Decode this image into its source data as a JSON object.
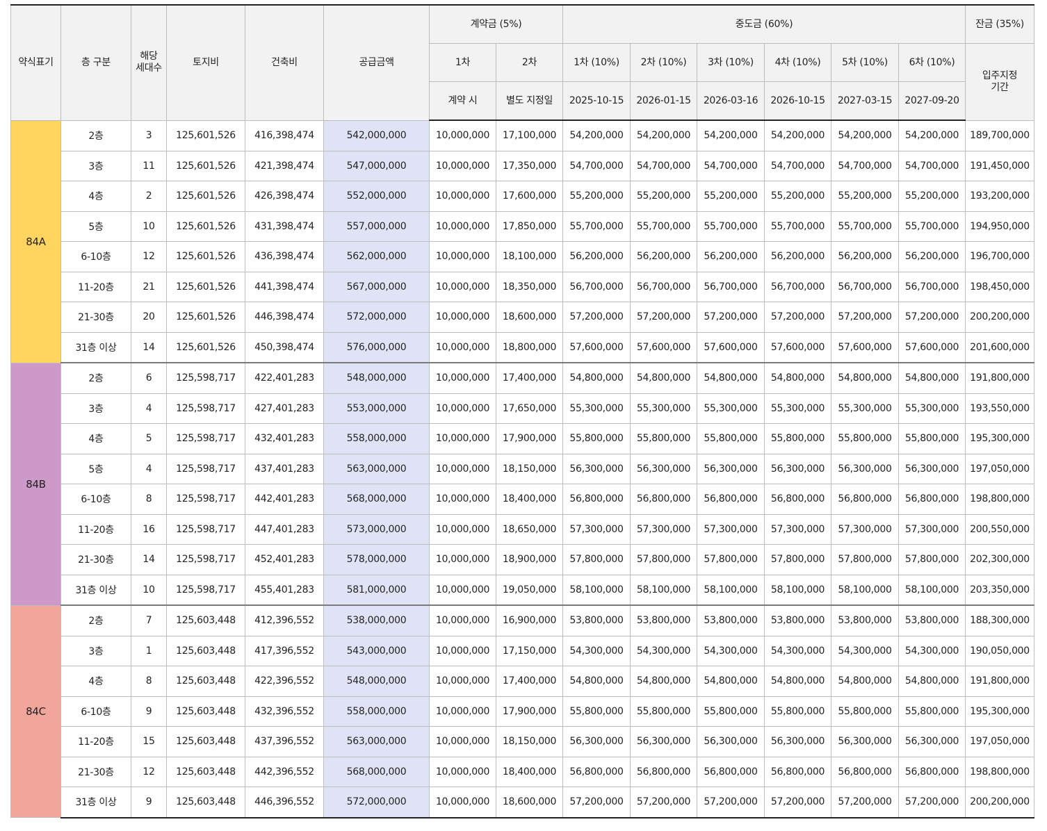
{
  "header": {
    "type": "약식표기",
    "floor": "층 구분",
    "units": "해당\n세대수",
    "land": "토지비",
    "building": "건축비",
    "supply": "공급금액",
    "deposit_group": "계약금 (5%)",
    "middle_group": "중도금 (60%)",
    "balance_group": "잔금 (35%)",
    "dep1": "1차",
    "dep2": "2차",
    "mid1": "1차 (10%)",
    "mid2": "2차 (10%)",
    "mid3": "3차 (10%)",
    "mid4": "4차 (10%)",
    "mid5": "5차 (10%)",
    "mid6": "6차 (10%)",
    "balance_sub": "입주지정\n기간",
    "dep1_date": "계약 시",
    "dep2_date": "별도 지정일",
    "mid1_date": "2025-10-15",
    "mid2_date": "2026-01-15",
    "mid3_date": "2026-03-16",
    "mid4_date": "2026-10-15",
    "mid5_date": "2027-03-15",
    "mid6_date": "2027-09-20"
  },
  "groups": [
    {
      "type": "84A",
      "color": "#ffd45f",
      "rows": [
        {
          "floor": "2층",
          "units": "3",
          "land": "125,601,526",
          "building": "416,398,474",
          "supply": "542,000,000",
          "dep1": "10,000,000",
          "dep2": "17,100,000",
          "mid": "54,200,000",
          "balance": "189,700,000"
        },
        {
          "floor": "3층",
          "units": "11",
          "land": "125,601,526",
          "building": "421,398,474",
          "supply": "547,000,000",
          "dep1": "10,000,000",
          "dep2": "17,350,000",
          "mid": "54,700,000",
          "balance": "191,450,000"
        },
        {
          "floor": "4층",
          "units": "2",
          "land": "125,601,526",
          "building": "426,398,474",
          "supply": "552,000,000",
          "dep1": "10,000,000",
          "dep2": "17,600,000",
          "mid": "55,200,000",
          "balance": "193,200,000"
        },
        {
          "floor": "5층",
          "units": "10",
          "land": "125,601,526",
          "building": "431,398,474",
          "supply": "557,000,000",
          "dep1": "10,000,000",
          "dep2": "17,850,000",
          "mid": "55,700,000",
          "balance": "194,950,000"
        },
        {
          "floor": "6-10층",
          "units": "12",
          "land": "125,601,526",
          "building": "436,398,474",
          "supply": "562,000,000",
          "dep1": "10,000,000",
          "dep2": "18,100,000",
          "mid": "56,200,000",
          "balance": "196,700,000"
        },
        {
          "floor": "11-20층",
          "units": "21",
          "land": "125,601,526",
          "building": "441,398,474",
          "supply": "567,000,000",
          "dep1": "10,000,000",
          "dep2": "18,350,000",
          "mid": "56,700,000",
          "balance": "198,450,000"
        },
        {
          "floor": "21-30층",
          "units": "20",
          "land": "125,601,526",
          "building": "446,398,474",
          "supply": "572,000,000",
          "dep1": "10,000,000",
          "dep2": "18,600,000",
          "mid": "57,200,000",
          "balance": "200,200,000"
        },
        {
          "floor": "31층 이상",
          "units": "14",
          "land": "125,601,526",
          "building": "450,398,474",
          "supply": "576,000,000",
          "dep1": "10,000,000",
          "dep2": "18,800,000",
          "mid": "57,600,000",
          "balance": "201,600,000"
        }
      ]
    },
    {
      "type": "84B",
      "color": "#cc99c8",
      "rows": [
        {
          "floor": "2층",
          "units": "6",
          "land": "125,598,717",
          "building": "422,401,283",
          "supply": "548,000,000",
          "dep1": "10,000,000",
          "dep2": "17,400,000",
          "mid": "54,800,000",
          "balance": "191,800,000"
        },
        {
          "floor": "3층",
          "units": "4",
          "land": "125,598,717",
          "building": "427,401,283",
          "supply": "553,000,000",
          "dep1": "10,000,000",
          "dep2": "17,650,000",
          "mid": "55,300,000",
          "balance": "193,550,000"
        },
        {
          "floor": "4층",
          "units": "5",
          "land": "125,598,717",
          "building": "432,401,283",
          "supply": "558,000,000",
          "dep1": "10,000,000",
          "dep2": "17,900,000",
          "mid": "55,800,000",
          "balance": "195,300,000"
        },
        {
          "floor": "5층",
          "units": "4",
          "land": "125,598,717",
          "building": "437,401,283",
          "supply": "563,000,000",
          "dep1": "10,000,000",
          "dep2": "18,150,000",
          "mid": "56,300,000",
          "balance": "197,050,000"
        },
        {
          "floor": "6-10층",
          "units": "8",
          "land": "125,598,717",
          "building": "442,401,283",
          "supply": "568,000,000",
          "dep1": "10,000,000",
          "dep2": "18,400,000",
          "mid": "56,800,000",
          "balance": "198,800,000"
        },
        {
          "floor": "11-20층",
          "units": "16",
          "land": "125,598,717",
          "building": "447,401,283",
          "supply": "573,000,000",
          "dep1": "10,000,000",
          "dep2": "18,650,000",
          "mid": "57,300,000",
          "balance": "200,550,000"
        },
        {
          "floor": "21-30층",
          "units": "14",
          "land": "125,598,717",
          "building": "452,401,283",
          "supply": "578,000,000",
          "dep1": "10,000,000",
          "dep2": "18,900,000",
          "mid": "57,800,000",
          "balance": "202,300,000"
        },
        {
          "floor": "31층 이상",
          "units": "10",
          "land": "125,598,717",
          "building": "455,401,283",
          "supply": "581,000,000",
          "dep1": "10,000,000",
          "dep2": "19,050,000",
          "mid": "58,100,000",
          "balance": "203,350,000"
        }
      ]
    },
    {
      "type": "84C",
      "color": "#f2a59b",
      "rows": [
        {
          "floor": "2층",
          "units": "7",
          "land": "125,603,448",
          "building": "412,396,552",
          "supply": "538,000,000",
          "dep1": "10,000,000",
          "dep2": "16,900,000",
          "mid": "53,800,000",
          "balance": "188,300,000"
        },
        {
          "floor": "3층",
          "units": "1",
          "land": "125,603,448",
          "building": "417,396,552",
          "supply": "543,000,000",
          "dep1": "10,000,000",
          "dep2": "17,150,000",
          "mid": "54,300,000",
          "balance": "190,050,000"
        },
        {
          "floor": "4층",
          "units": "8",
          "land": "125,603,448",
          "building": "422,396,552",
          "supply": "548,000,000",
          "dep1": "10,000,000",
          "dep2": "17,400,000",
          "mid": "54,800,000",
          "balance": "191,800,000"
        },
        {
          "floor": "6-10층",
          "units": "9",
          "land": "125,603,448",
          "building": "432,396,552",
          "supply": "558,000,000",
          "dep1": "10,000,000",
          "dep2": "17,900,000",
          "mid": "55,800,000",
          "balance": "195,300,000"
        },
        {
          "floor": "11-20층",
          "units": "15",
          "land": "125,603,448",
          "building": "437,396,552",
          "supply": "563,000,000",
          "dep1": "10,000,000",
          "dep2": "18,150,000",
          "mid": "56,300,000",
          "balance": "197,050,000"
        },
        {
          "floor": "21-30층",
          "units": "12",
          "land": "125,603,448",
          "building": "442,396,552",
          "supply": "568,000,000",
          "dep1": "10,000,000",
          "dep2": "18,400,000",
          "mid": "56,800,000",
          "balance": "198,800,000"
        },
        {
          "floor": "31층 이상",
          "units": "9",
          "land": "125,603,448",
          "building": "446,396,552",
          "supply": "572,000,000",
          "dep1": "10,000,000",
          "dep2": "18,600,000",
          "mid": "57,200,000",
          "balance": "200,200,000"
        }
      ]
    }
  ]
}
